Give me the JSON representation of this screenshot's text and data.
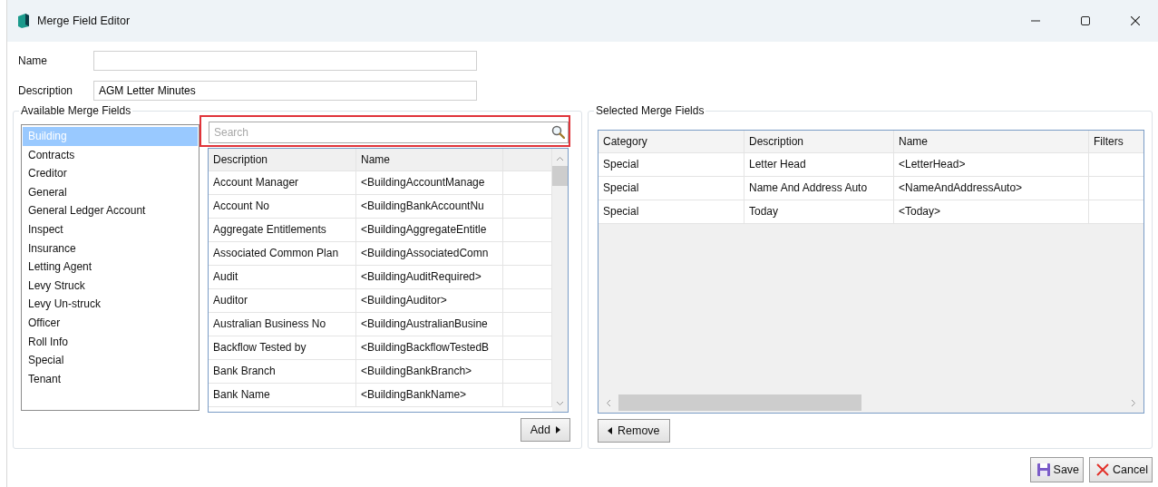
{
  "window": {
    "title": "Merge Field Editor"
  },
  "form": {
    "name": {
      "label": "Name"
    },
    "description": {
      "label": "Description",
      "value": "AGM Letter Minutes"
    }
  },
  "available": {
    "title": "Available Merge Fields",
    "categories": [
      {
        "label": "Building",
        "selected": true
      },
      {
        "label": "Contracts",
        "selected": false
      },
      {
        "label": "Creditor",
        "selected": false
      },
      {
        "label": "General",
        "selected": false
      },
      {
        "label": "General Ledger Account",
        "selected": false
      },
      {
        "label": "Inspect",
        "selected": false
      },
      {
        "label": "Insurance",
        "selected": false
      },
      {
        "label": "Letting Agent",
        "selected": false
      },
      {
        "label": "Levy Struck",
        "selected": false
      },
      {
        "label": "Levy Un-struck",
        "selected": false
      },
      {
        "label": "Officer",
        "selected": false
      },
      {
        "label": "Roll Info",
        "selected": false
      },
      {
        "label": "Special",
        "selected": false
      },
      {
        "label": "Tenant",
        "selected": false
      }
    ],
    "search": {
      "placeholder": "Search",
      "highlighted": true
    },
    "columns": [
      "Description",
      "Name"
    ],
    "rows": [
      [
        "Account Manager",
        "<BuildingAccountManage"
      ],
      [
        "Account No",
        "<BuildingBankAccountNu"
      ],
      [
        "Aggregate Entitlements",
        "<BuildingAggregateEntitle"
      ],
      [
        "Associated Common Plan",
        "<BuildingAssociatedComn"
      ],
      [
        "Audit",
        "<BuildingAuditRequired>"
      ],
      [
        "Auditor",
        "<BuildingAuditor>"
      ],
      [
        "Australian Business No",
        "<BuildingAustralianBusine"
      ],
      [
        "Backflow Tested by",
        "<BuildingBackflowTestedB"
      ],
      [
        "Bank Branch",
        "<BuildingBankBranch>"
      ],
      [
        "Bank Name",
        "<BuildingBankName>"
      ]
    ],
    "add_button": "Add"
  },
  "selected": {
    "title": "Selected Merge Fields",
    "columns": [
      "Category",
      "Description",
      "Name",
      "Filters"
    ],
    "rows": [
      [
        "Special",
        "Letter Head",
        "<LetterHead>",
        ""
      ],
      [
        "Special",
        "Name And Address Auto",
        "<NameAndAddressAuto>",
        ""
      ],
      [
        "Special",
        "Today",
        "<Today>",
        ""
      ]
    ],
    "remove_button": "Remove"
  },
  "buttons": [
    {
      "kind": "save",
      "label": "Save"
    },
    {
      "kind": "cancel",
      "label": "Cancel"
    }
  ]
}
